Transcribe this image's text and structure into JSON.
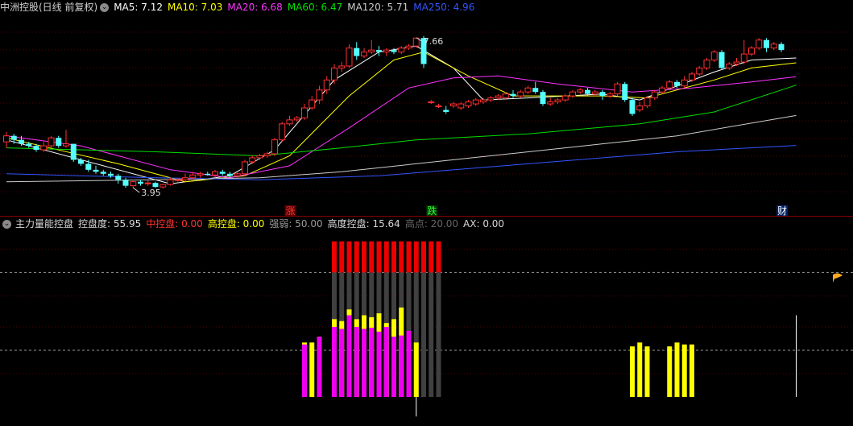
{
  "main": {
    "title": "中洲控股(日线 前复权)",
    "ma": [
      {
        "label": "MA5: 7.12",
        "color": "#ffffff"
      },
      {
        "label": "MA10: 7.03",
        "color": "#ffff00"
      },
      {
        "label": "MA20: 6.68",
        "color": "#ff33ff"
      },
      {
        "label": "MA60: 6.47",
        "color": "#00dd00"
      },
      {
        "label": "MA120: 5.71",
        "color": "#cccccc"
      },
      {
        "label": "MA250: 4.96",
        "color": "#3355ff"
      }
    ],
    "high_label": "7.66",
    "low_label": "3.95",
    "markers": [
      {
        "text": "涨",
        "color": "#ff3333"
      },
      {
        "text": "跌",
        "color": "#33ff33"
      },
      {
        "text": "财",
        "color": "#ffffff"
      }
    ]
  },
  "indicator": {
    "name": "主力量能控盘",
    "values": [
      {
        "label": "控盘度: 55.95",
        "color": "#d8d8d8"
      },
      {
        "label": "中控盘: 0.00",
        "color": "#ff3333"
      },
      {
        "label": "高控盘: 0.00",
        "color": "#ffff00"
      },
      {
        "label": "强弱: 50.00",
        "color": "#9a9a9a"
      },
      {
        "label": "高度控盘: 15.64",
        "color": "#d8d8d8"
      },
      {
        "label": "高点: 20.00",
        "color": "#666666"
      },
      {
        "label": "AX: 0.00",
        "color": "#d8d8d8"
      }
    ]
  },
  "chart_data": {
    "type": "candlestick",
    "ylim": [
      3.6,
      8.2
    ],
    "candles": [
      [
        5.05,
        5.2,
        5.3,
        4.9
      ],
      [
        5.2,
        5.1,
        5.25,
        5.0
      ],
      [
        5.1,
        5.0,
        5.2,
        4.95
      ],
      [
        5.0,
        4.95,
        5.05,
        4.9
      ],
      [
        4.95,
        4.85,
        5.0,
        4.8
      ],
      [
        4.85,
        4.95,
        5.05,
        4.8
      ],
      [
        4.95,
        5.15,
        5.2,
        4.9
      ],
      [
        5.15,
        4.95,
        5.2,
        4.9
      ],
      [
        4.95,
        5.0,
        5.35,
        4.9
      ],
      [
        5.0,
        4.6,
        5.0,
        4.55
      ],
      [
        4.6,
        4.5,
        4.65,
        4.45
      ],
      [
        4.5,
        4.35,
        4.6,
        4.3
      ],
      [
        4.35,
        4.3,
        4.45,
        4.25
      ],
      [
        4.3,
        4.25,
        4.35,
        4.2
      ],
      [
        4.25,
        4.2,
        4.3,
        4.15
      ],
      [
        4.2,
        4.1,
        4.25,
        4.0
      ],
      [
        4.1,
        3.95,
        4.15,
        3.9
      ],
      [
        3.95,
        4.05,
        4.1,
        3.9
      ],
      [
        4.05,
        4.0,
        4.1,
        3.95
      ],
      [
        4.0,
        4.02,
        4.08,
        3.95
      ],
      [
        4.02,
        3.92,
        4.05,
        3.9
      ],
      [
        3.92,
        3.98,
        4.0,
        3.88
      ],
      [
        3.98,
        4.1,
        4.15,
        3.95
      ],
      [
        4.1,
        4.1,
        4.15,
        4.05
      ],
      [
        4.1,
        4.15,
        4.25,
        4.05
      ],
      [
        4.15,
        4.22,
        4.3,
        4.1
      ],
      [
        4.22,
        4.25,
        4.3,
        4.15
      ],
      [
        4.25,
        4.22,
        4.3,
        4.2
      ],
      [
        4.22,
        4.3,
        4.35,
        4.15
      ],
      [
        4.3,
        4.25,
        4.35,
        4.2
      ],
      [
        4.25,
        4.2,
        4.3,
        4.15
      ],
      [
        4.2,
        4.25,
        4.3,
        4.15
      ],
      [
        4.25,
        4.55,
        4.6,
        4.2
      ],
      [
        4.55,
        4.65,
        4.7,
        4.5
      ],
      [
        4.65,
        4.7,
        4.75,
        4.6
      ],
      [
        4.7,
        4.75,
        4.8,
        4.65
      ],
      [
        4.75,
        5.1,
        5.15,
        4.7
      ],
      [
        5.1,
        5.5,
        5.55,
        5.05
      ],
      [
        5.5,
        5.6,
        5.7,
        5.45
      ],
      [
        5.6,
        5.65,
        5.7,
        5.55
      ],
      [
        5.65,
        5.9,
        6.0,
        5.6
      ],
      [
        5.9,
        6.1,
        6.2,
        5.85
      ],
      [
        6.1,
        6.35,
        6.45,
        6.0
      ],
      [
        6.35,
        6.6,
        6.7,
        6.25
      ],
      [
        6.6,
        6.9,
        7.0,
        6.5
      ],
      [
        6.9,
        6.95,
        7.05,
        6.8
      ],
      [
        6.95,
        7.4,
        7.5,
        6.9
      ],
      [
        7.4,
        7.2,
        7.55,
        7.1
      ],
      [
        7.2,
        7.3,
        7.4,
        7.15
      ],
      [
        7.3,
        7.35,
        7.6,
        7.25
      ],
      [
        7.35,
        7.3,
        7.45,
        7.2
      ],
      [
        7.3,
        7.35,
        7.4,
        7.2
      ],
      [
        7.35,
        7.3,
        7.4,
        7.25
      ],
      [
        7.3,
        7.4,
        7.45,
        7.25
      ],
      [
        7.4,
        7.45,
        7.5,
        7.35
      ],
      [
        7.45,
        7.65,
        7.66,
        7.4
      ],
      [
        7.65,
        7.0,
        7.7,
        6.9
      ],
      [
        6.05,
        6.05,
        6.1,
        6.0
      ],
      [
        5.95,
        5.95,
        6.0,
        5.9
      ],
      [
        5.85,
        5.8,
        5.95,
        5.75
      ],
      [
        5.95,
        6.0,
        6.05,
        5.9
      ],
      [
        5.9,
        6.0,
        6.05,
        5.85
      ],
      [
        5.95,
        6.05,
        6.1,
        5.9
      ],
      [
        6.0,
        6.1,
        6.15,
        5.95
      ],
      [
        6.05,
        6.1,
        6.15,
        6.0
      ],
      [
        6.1,
        6.15,
        6.2,
        6.05
      ],
      [
        6.15,
        6.2,
        6.25,
        6.1
      ],
      [
        6.15,
        6.25,
        6.3,
        6.1
      ],
      [
        6.25,
        6.2,
        6.35,
        6.15
      ],
      [
        6.2,
        6.3,
        6.35,
        6.15
      ],
      [
        6.3,
        6.4,
        6.45,
        6.25
      ],
      [
        6.4,
        6.3,
        6.55,
        6.25
      ],
      [
        6.3,
        6.0,
        6.35,
        5.95
      ],
      [
        6.0,
        6.05,
        6.15,
        5.95
      ],
      [
        6.05,
        6.1,
        6.15,
        6.0
      ],
      [
        6.1,
        6.2,
        6.25,
        6.05
      ],
      [
        6.2,
        6.3,
        6.35,
        6.15
      ],
      [
        6.3,
        6.35,
        6.4,
        6.25
      ],
      [
        6.35,
        6.25,
        6.4,
        6.2
      ],
      [
        6.25,
        6.3,
        6.35,
        6.2
      ],
      [
        6.3,
        6.2,
        6.35,
        6.1
      ],
      [
        6.2,
        6.25,
        6.3,
        6.15
      ],
      [
        6.25,
        6.5,
        6.55,
        6.2
      ],
      [
        6.5,
        6.1,
        6.55,
        6.05
      ],
      [
        6.1,
        5.75,
        6.15,
        5.7
      ],
      [
        5.85,
        5.95,
        6.05,
        5.8
      ],
      [
        5.95,
        6.15,
        6.2,
        5.9
      ],
      [
        6.15,
        6.3,
        6.35,
        6.1
      ],
      [
        6.3,
        6.4,
        6.45,
        6.25
      ],
      [
        6.4,
        6.55,
        6.6,
        6.35
      ],
      [
        6.55,
        6.45,
        6.6,
        6.4
      ],
      [
        6.45,
        6.6,
        6.7,
        6.4
      ],
      [
        6.6,
        6.75,
        6.8,
        6.55
      ],
      [
        6.75,
        6.9,
        6.95,
        6.7
      ],
      [
        6.9,
        7.1,
        7.15,
        6.85
      ],
      [
        7.1,
        7.3,
        7.35,
        7.05
      ],
      [
        7.3,
        6.9,
        7.35,
        6.85
      ],
      [
        6.9,
        7.0,
        7.05,
        6.85
      ],
      [
        7.0,
        7.05,
        7.15,
        6.95
      ],
      [
        7.05,
        7.25,
        7.6,
        7.0
      ],
      [
        7.25,
        7.4,
        7.45,
        7.2
      ],
      [
        7.4,
        7.6,
        7.65,
        7.35
      ],
      [
        7.6,
        7.4,
        7.65,
        7.3
      ],
      [
        7.4,
        7.5,
        7.55,
        7.35
      ],
      [
        7.5,
        7.35,
        7.55,
        7.3
      ]
    ],
    "ma_lines": {
      "MA5": [
        [
          0,
          5.1
        ],
        [
          15,
          4.35
        ],
        [
          22,
          4.0
        ],
        [
          30,
          4.2
        ],
        [
          36,
          4.85
        ],
        [
          44,
          6.6
        ],
        [
          50,
          7.3
        ],
        [
          55,
          7.45
        ],
        [
          60,
          6.9
        ],
        [
          64,
          6.1
        ],
        [
          70,
          6.15
        ],
        [
          80,
          6.25
        ],
        [
          85,
          6.1
        ],
        [
          95,
          6.8
        ],
        [
          100,
          7.1
        ],
        [
          106,
          7.15
        ]
      ],
      "MA10": [
        [
          0,
          5.15
        ],
        [
          15,
          4.5
        ],
        [
          24,
          4.05
        ],
        [
          32,
          4.2
        ],
        [
          38,
          4.7
        ],
        [
          46,
          6.2
        ],
        [
          52,
          7.1
        ],
        [
          56,
          7.3
        ],
        [
          62,
          6.7
        ],
        [
          68,
          6.2
        ],
        [
          80,
          6.2
        ],
        [
          86,
          6.15
        ],
        [
          95,
          6.6
        ],
        [
          100,
          6.9
        ],
        [
          106,
          7.03
        ]
      ],
      "MA20": [
        [
          0,
          5.2
        ],
        [
          10,
          4.95
        ],
        [
          22,
          4.35
        ],
        [
          30,
          4.15
        ],
        [
          38,
          4.45
        ],
        [
          46,
          5.4
        ],
        [
          54,
          6.4
        ],
        [
          60,
          6.65
        ],
        [
          66,
          6.7
        ],
        [
          74,
          6.5
        ],
        [
          84,
          6.3
        ],
        [
          92,
          6.4
        ],
        [
          100,
          6.55
        ],
        [
          106,
          6.68
        ]
      ],
      "MA60": [
        [
          0,
          4.9
        ],
        [
          20,
          4.8
        ],
        [
          34,
          4.7
        ],
        [
          45,
          4.9
        ],
        [
          55,
          5.1
        ],
        [
          70,
          5.25
        ],
        [
          85,
          5.5
        ],
        [
          95,
          5.8
        ],
        [
          106,
          6.47
        ]
      ],
      "MA120": [
        [
          0,
          4.05
        ],
        [
          20,
          4.1
        ],
        [
          34,
          4.15
        ],
        [
          45,
          4.3
        ],
        [
          60,
          4.6
        ],
        [
          75,
          4.9
        ],
        [
          90,
          5.2
        ],
        [
          106,
          5.71
        ]
      ],
      "MA250": [
        [
          0,
          4.25
        ],
        [
          20,
          4.15
        ],
        [
          34,
          4.1
        ],
        [
          50,
          4.2
        ],
        [
          70,
          4.5
        ],
        [
          90,
          4.8
        ],
        [
          106,
          4.96
        ]
      ]
    },
    "sub": {
      "ylim": [
        -6,
        42
      ],
      "ref_lines": [
        32,
        12
      ],
      "red": {
        "from": 44,
        "to": 58,
        "top": 40,
        "base": 32
      },
      "gray": {
        "from": 44,
        "to": 58,
        "top": 32
      },
      "magenta": [
        [
          40,
          13.5
        ],
        [
          42,
          15.5
        ],
        [
          44,
          18
        ],
        [
          45,
          17.5
        ],
        [
          46,
          21
        ],
        [
          47,
          18
        ],
        [
          48,
          17.5
        ],
        [
          49,
          17.8
        ],
        [
          50,
          16.8
        ],
        [
          51,
          18
        ],
        [
          52,
          15.5
        ],
        [
          53,
          15.8
        ],
        [
          54,
          17
        ]
      ],
      "yellow": [
        [
          40,
          14
        ],
        [
          41,
          14
        ],
        [
          42,
          15.5
        ],
        [
          44,
          20
        ],
        [
          45,
          19.5
        ],
        [
          46,
          22.5
        ],
        [
          47,
          20
        ],
        [
          48,
          21
        ],
        [
          49,
          20.5
        ],
        [
          50,
          21.5
        ],
        [
          51,
          19
        ],
        [
          52,
          20
        ],
        [
          53,
          23
        ],
        [
          55,
          14
        ],
        [
          84,
          13
        ],
        [
          85,
          14
        ],
        [
          86,
          13
        ],
        [
          89,
          13
        ],
        [
          90,
          14
        ],
        [
          91,
          13.5
        ],
        [
          92,
          13.5
        ]
      ],
      "white_down": 55,
      "white_up": 106
    },
    "marker_idx": [
      38,
      57,
      104
    ],
    "high_idx": 55,
    "low_idx": 17
  }
}
